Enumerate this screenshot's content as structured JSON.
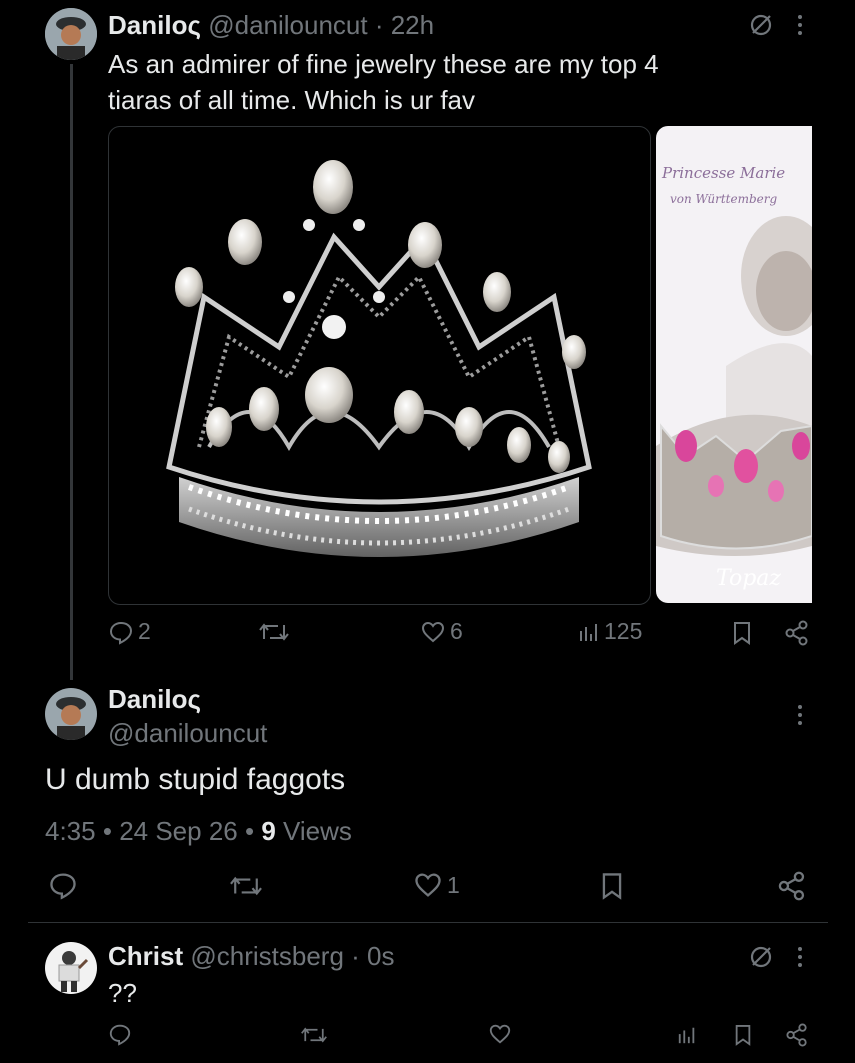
{
  "parent_tweet": {
    "display_name": "Danilo",
    "name_glyph": "ς",
    "handle": "@danilouncut",
    "time": "22h",
    "text_line1": "As an admirer of fine jewelry these are my top 4",
    "text_line2": "tiaras of all time. Which is ur fav",
    "image2_caption_1": "Princesse Marie",
    "image2_caption_2": "von Württemberg",
    "image2_caption_3": "Topaz",
    "actions": {
      "replies": "2",
      "likes": "6",
      "views": "125"
    }
  },
  "focused_tweet": {
    "display_name": "Danilo",
    "name_glyph": "ς",
    "handle": "@danilouncut",
    "text": "U dumb stupid faggots",
    "time": "4:35",
    "date": "24 Sep 26",
    "views_count": "9",
    "views_label": "Views",
    "separator": "•",
    "actions": {
      "likes": "1"
    }
  },
  "reply_tweet": {
    "display_name": "Christ",
    "handle": "@christsberg",
    "time": "0s",
    "text": "??"
  },
  "icons": {
    "more": "more-dots-icon",
    "grok": "slash-circle-icon",
    "reply": "reply-icon",
    "retweet": "retweet-icon",
    "like": "heart-icon",
    "views": "views-icon",
    "bookmark": "bookmark-icon",
    "share": "share-icon"
  },
  "colors": {
    "background": "#000000",
    "text": "#e7e9ea",
    "muted": "#71767b",
    "divider": "#2f3336"
  }
}
